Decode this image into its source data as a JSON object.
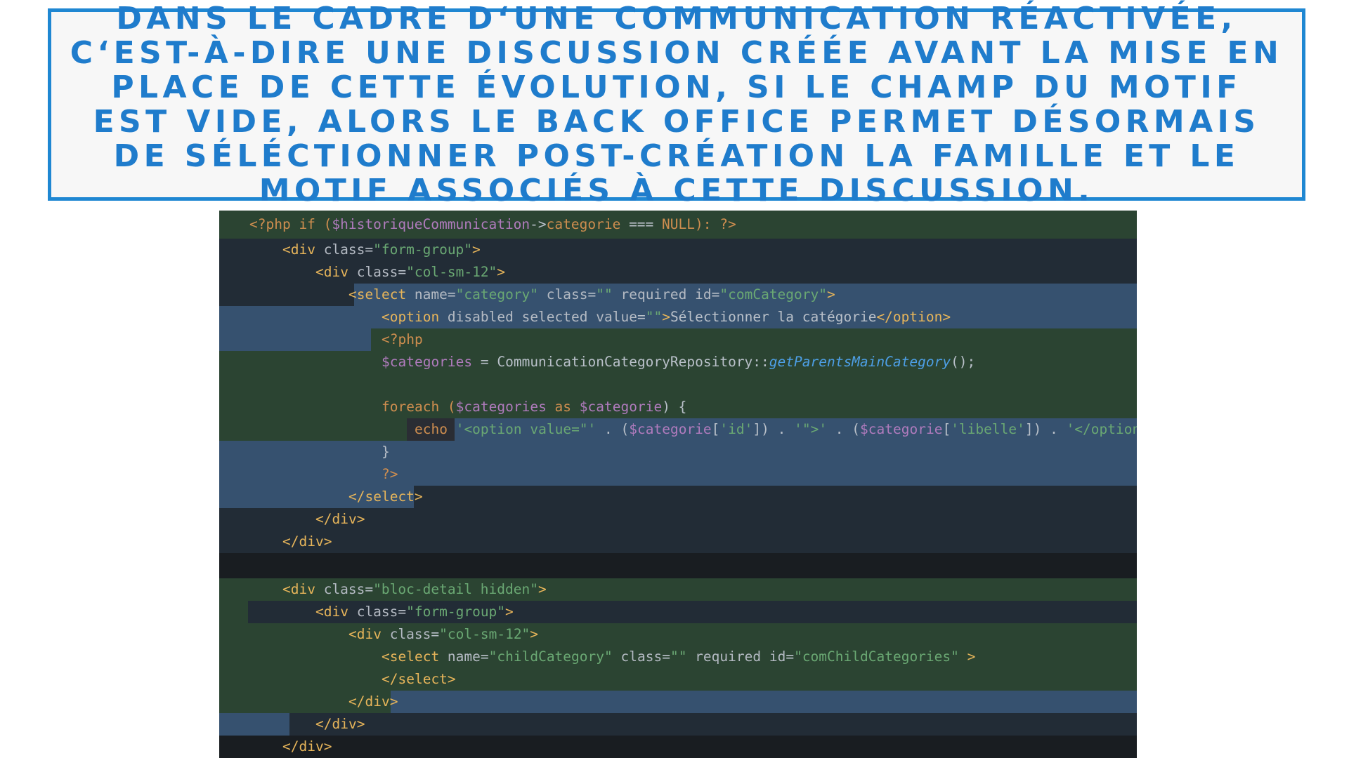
{
  "banner": {
    "text": "Dans le cadre d‘une communication réactivée, c‘est-à-dire une discussion créée avant la mise en place de cette évolution, si le champ du motif est vide, alors le back office permet désormais de séléctionner post-création la famille et le motif associés à cette discussion."
  },
  "colors": {
    "banner_border": "#1f87d2",
    "banner_text": "#1f7ccc",
    "editor_bg": "#222c36",
    "diff_added": "#2b4432",
    "selection": "#36516f",
    "gap": "#191d21"
  },
  "code": {
    "lines": [
      [
        [
          "<?php if (",
          "kw"
        ],
        [
          "$historiqueCommunication",
          "vr"
        ],
        [
          "->",
          "pn"
        ],
        [
          "categorie",
          "kw"
        ],
        [
          " === ",
          "pn"
        ],
        [
          "NULL",
          "kw"
        ],
        [
          "): ?>",
          "kw"
        ]
      ],
      [
        [
          "<div ",
          "tg"
        ],
        [
          "class",
          "at"
        ],
        [
          "=",
          "pn"
        ],
        [
          "\"form-group\"",
          "st"
        ],
        [
          ">",
          "tg"
        ]
      ],
      [
        [
          "<div ",
          "tg"
        ],
        [
          "class",
          "at"
        ],
        [
          "=",
          "pn"
        ],
        [
          "\"col-sm-12\"",
          "st"
        ],
        [
          ">",
          "tg"
        ]
      ],
      [
        [
          "<select ",
          "tg"
        ],
        [
          "name",
          "at"
        ],
        [
          "=",
          "pn"
        ],
        [
          "\"category\"",
          "st"
        ],
        [
          " class",
          "at"
        ],
        [
          "=",
          "pn"
        ],
        [
          "\"\"",
          "st"
        ],
        [
          " required id",
          "at"
        ],
        [
          "=",
          "pn"
        ],
        [
          "\"comCategory\"",
          "st"
        ],
        [
          ">",
          "tg"
        ]
      ],
      [
        [
          "<option ",
          "tg"
        ],
        [
          "disabled selected value",
          "at"
        ],
        [
          "=",
          "pn"
        ],
        [
          "\"\"",
          "st"
        ],
        [
          ">",
          "tg"
        ],
        [
          "Sélectionner la catégorie",
          "pn"
        ],
        [
          "</option>",
          "tg"
        ]
      ],
      [
        [
          "<?php",
          "kw"
        ]
      ],
      [
        [
          "$categories",
          "vr"
        ],
        [
          " = CommunicationCategoryRepository::",
          "pn"
        ],
        [
          "getParentsMainCategory",
          "fn"
        ],
        [
          "();",
          "pn"
        ]
      ],
      [],
      [
        [
          "foreach (",
          "kw"
        ],
        [
          "$categories",
          "vr"
        ],
        [
          " as ",
          "kw"
        ],
        [
          "$categorie",
          "vr"
        ],
        [
          ") {",
          "pn"
        ]
      ],
      [
        [
          "echo ",
          "kw"
        ],
        [
          "'<option value=\"'",
          "st"
        ],
        [
          " . (",
          "pn"
        ],
        [
          "$categorie",
          "vr"
        ],
        [
          "[",
          "pn"
        ],
        [
          "'id'",
          "st"
        ],
        [
          "]) . ",
          "pn"
        ],
        [
          "'\">'",
          "st"
        ],
        [
          " . (",
          "pn"
        ],
        [
          "$categorie",
          "vr"
        ],
        [
          "[",
          "pn"
        ],
        [
          "'libelle'",
          "st"
        ],
        [
          "]) . ",
          "pn"
        ],
        [
          "'</option>';",
          "st"
        ]
      ],
      [
        [
          "}",
          "pn"
        ]
      ],
      [
        [
          "?>",
          "kw"
        ]
      ],
      [
        [
          "</select>",
          "tg"
        ]
      ],
      [
        [
          "</div>",
          "tg"
        ]
      ],
      [
        [
          "</div>",
          "tg"
        ]
      ],
      [],
      [
        [
          "<div ",
          "tg"
        ],
        [
          "class",
          "at"
        ],
        [
          "=",
          "pn"
        ],
        [
          "\"bloc-detail hidden\"",
          "st"
        ],
        [
          ">",
          "tg"
        ]
      ],
      [
        [
          "<div ",
          "tg"
        ],
        [
          "class",
          "at"
        ],
        [
          "=",
          "pn"
        ],
        [
          "\"form-group\"",
          "st"
        ],
        [
          ">",
          "tg"
        ]
      ],
      [
        [
          "<div ",
          "tg"
        ],
        [
          "class",
          "at"
        ],
        [
          "=",
          "pn"
        ],
        [
          "\"col-sm-12\"",
          "st"
        ],
        [
          ">",
          "tg"
        ]
      ],
      [
        [
          "<select ",
          "tg"
        ],
        [
          "name",
          "at"
        ],
        [
          "=",
          "pn"
        ],
        [
          "\"childCategory\"",
          "st"
        ],
        [
          " class",
          "at"
        ],
        [
          "=",
          "pn"
        ],
        [
          "\"\"",
          "st"
        ],
        [
          " required id",
          "at"
        ],
        [
          "=",
          "pn"
        ],
        [
          "\"comChildCategories\"",
          "st"
        ],
        [
          " >",
          "tg"
        ]
      ],
      [
        [
          "</select>",
          "tg"
        ]
      ],
      [
        [
          "</div>",
          "tg"
        ]
      ],
      [
        [
          "</div>",
          "tg"
        ]
      ],
      [
        [
          "</div>",
          "tg"
        ]
      ]
    ]
  }
}
